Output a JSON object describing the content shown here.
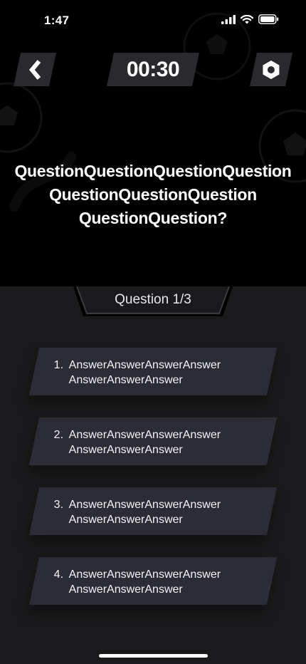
{
  "status_bar": {
    "time": "1:47"
  },
  "header": {
    "back_icon": "chevron-left-icon",
    "timer": "00:30",
    "settings_icon": "hexagon-gear-icon"
  },
  "question": {
    "lines": [
      "QuestionQuestionQuestionQuestion",
      "QuestionQuestionQuestion",
      "QuestionQuestion?"
    ]
  },
  "progress": {
    "counter": "Question 1/3"
  },
  "answers": [
    {
      "number": "1.",
      "lines": [
        "AnswerAnswerAnswerAnswer",
        "AnswerAnswerAnswer"
      ]
    },
    {
      "number": "2.",
      "lines": [
        "AnswerAnswerAnswerAnswer",
        "AnswerAnswerAnswer"
      ]
    },
    {
      "number": "3.",
      "lines": [
        "AnswerAnswerAnswerAnswer",
        "AnswerAnswerAnswer"
      ]
    },
    {
      "number": "4.",
      "lines": [
        "AnswerAnswerAnswerAnswer",
        "AnswerAnswerAnswer"
      ]
    }
  ],
  "colors": {
    "top_background": "#000000",
    "bottom_background": "#1a1a1c",
    "button_fill": "#2a2a2e",
    "answer_fill": "#2b2c36",
    "text": "#ffffff"
  }
}
